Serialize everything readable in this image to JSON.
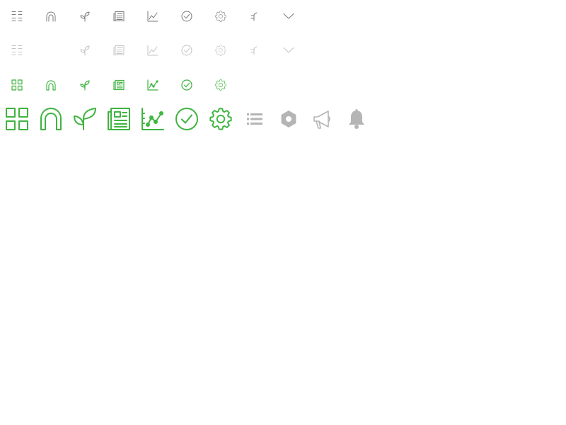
{
  "colors": {
    "row1": "#7a7a7a",
    "row2": "#c4c4c4",
    "accent": "#3fb43f",
    "grey": "#b5b5b5"
  },
  "sprite": {
    "row1": [
      "grid-icon",
      "arch-icon",
      "sprout-icon",
      "newspaper-icon",
      "line-chart-icon",
      "check-circle-icon",
      "gear-icon",
      "sprout-small-icon",
      "chevron-down-icon"
    ],
    "row2": [
      "grid-icon",
      "sprout-icon",
      "newspaper-icon",
      "line-chart-icon",
      "check-circle-icon",
      "gear-icon",
      "sprout-small-icon",
      "chevron-down-icon"
    ],
    "row3": [
      "grid-icon",
      "arch-icon",
      "sprout-icon",
      "newspaper-icon",
      "line-chart-icon",
      "check-circle-icon",
      "gear-icon"
    ],
    "row4": [
      "grid-icon",
      "arch-icon",
      "sprout-icon",
      "newspaper-icon",
      "line-chart-icon",
      "check-circle-icon",
      "gear-icon",
      "list-icon",
      "settings-badge-icon",
      "megaphone-icon",
      "bell-icon"
    ]
  }
}
